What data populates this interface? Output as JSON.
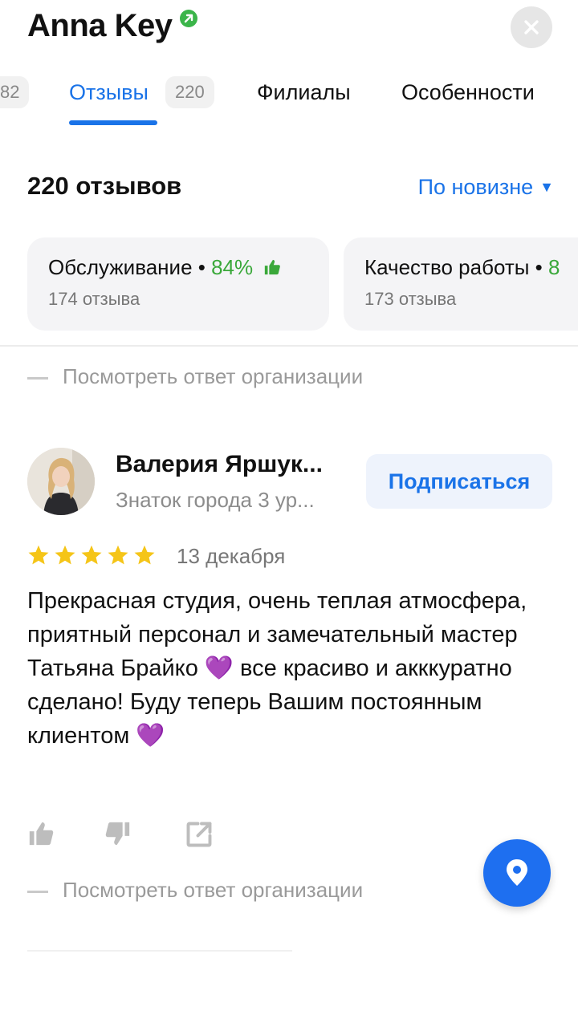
{
  "header": {
    "title": "Anna Key"
  },
  "tabs": [
    {
      "label": "",
      "count": "82"
    },
    {
      "label": "Отзывы",
      "count": "220",
      "active": true
    },
    {
      "label": "Филиалы",
      "count": ""
    },
    {
      "label": "Особенности",
      "count": ""
    }
  ],
  "reviews_summary": {
    "count_title": "220 отзывов",
    "sort_label": "По новизне"
  },
  "aspects": [
    {
      "name": "Обслуживание",
      "percent": "84%",
      "count": "174 отзыва"
    },
    {
      "name": "Качество работы",
      "percent": "8",
      "count": "173 отзыва"
    }
  ],
  "org_reply_label": "Посмотреть ответ организации",
  "review": {
    "author": "Валерия Яршук...",
    "level": "Знаток города 3 ур...",
    "subscribe_label": "Подписаться",
    "rating": 5,
    "date": "13 декабря",
    "text": "Прекрасная студия, очень теплая атмосфера, приятный персонал и замечательный мастер Татьяна Брайко 💜 все красиво и акккуратно сделано! Буду теперь Вашим постоянным клиентом 💜"
  },
  "colors": {
    "accent": "#1a73e8",
    "positive": "#3aa83a",
    "star": "#f5c518",
    "fab": "#1e6ff0"
  },
  "icons": {
    "verified": "verified-check-icon",
    "close": "close-icon",
    "like": "thumbs-up-icon",
    "dislike": "thumbs-down-icon",
    "share": "share-icon",
    "fab": "map-pin-icon"
  }
}
